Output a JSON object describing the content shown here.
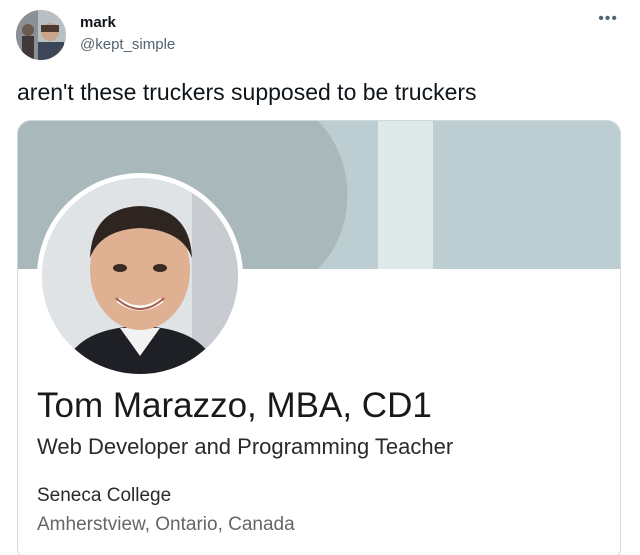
{
  "tweet": {
    "display_name": "mark",
    "handle": "@kept_simple",
    "more_icon": "more-horizontal-icon",
    "text": "aren't these truckers supposed to be truckers"
  },
  "profile_card": {
    "name": "Tom Marazzo, MBA, CD1",
    "headline": "Web Developer and Programming Teacher",
    "organization": "Seneca College",
    "location": "Amherstview, Ontario, Canada",
    "banner_colors": [
      "#a9b9bb",
      "#e0e9ea",
      "#bcced1"
    ]
  }
}
